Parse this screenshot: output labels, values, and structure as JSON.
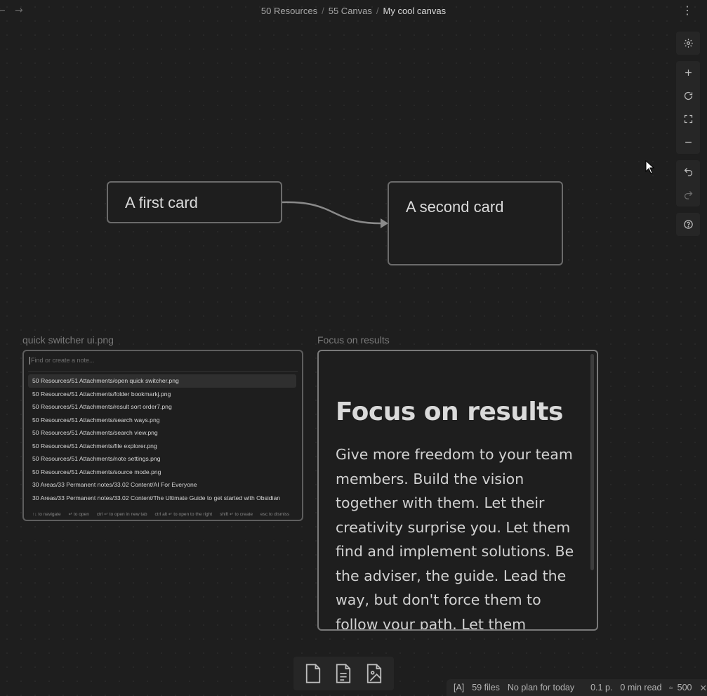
{
  "breadcrumb": {
    "items": [
      "50 Resources",
      "55 Canvas"
    ],
    "current": "My cool canvas",
    "separator": "/"
  },
  "icons": {
    "back": "back-arrow-icon",
    "forward": "forward-arrow-icon",
    "more": "more-options-icon"
  },
  "colors": {
    "canvas_bg": "#1e1e1e",
    "card_border": "#6b6b6b",
    "edge": "#8a8a8a"
  },
  "cards": {
    "first": {
      "text": "A first card"
    },
    "second": {
      "text": "A second card"
    }
  },
  "quick_switcher": {
    "label": "quick switcher ui.png",
    "placeholder": "Find or create a note...",
    "items": [
      "50 Resources/51 Attachments/open quick switcher.png",
      "50 Resources/51 Attachments/folder bookmarkj.png",
      "50 Resources/51 Attachments/result sort order7.png",
      "50 Resources/51 Attachments/search ways.png",
      "50 Resources/51 Attachments/search view.png",
      "50 Resources/51 Attachments/file explorer.png",
      "50 Resources/51 Attachments/note settings.png",
      "50 Resources/51 Attachments/source mode.png",
      "30 Areas/33 Permanent notes/33.02 Content/AI For Everyone",
      "30 Areas/33 Permanent notes/33.02 Content/The Ultimate Guide to get started with Obsidian"
    ],
    "footer": [
      "↑↓ to navigate",
      "↵ to open",
      "ctrl ↵ to open in new tab",
      "ctrl alt ↵ to open to the right",
      "shift ↵ to create",
      "esc to dismiss"
    ]
  },
  "focus_card": {
    "label": "Focus on results",
    "title": "Focus on results",
    "body": "Give more freedom to your team members. Build the vision together with them. Let their creativity surprise you. Let them find and implement solutions. Be the adviser, the guide. Lead the way, but don't force them to follow your path. Let them"
  },
  "controls": [
    "settings-icon",
    "zoom-in-icon",
    "reset-zoom-icon",
    "zoom-to-fit-icon",
    "zoom-out-icon",
    "undo-icon",
    "redo-icon",
    "help-icon"
  ],
  "bottom_bar": [
    "add-card-icon",
    "add-note-icon",
    "add-media-icon"
  ],
  "status_bar": {
    "vim_mode": "[A]",
    "files": "59 files",
    "plan": "No plan for today",
    "pages": "0.1 p.",
    "read_time": "0 min read",
    "words": "500"
  }
}
